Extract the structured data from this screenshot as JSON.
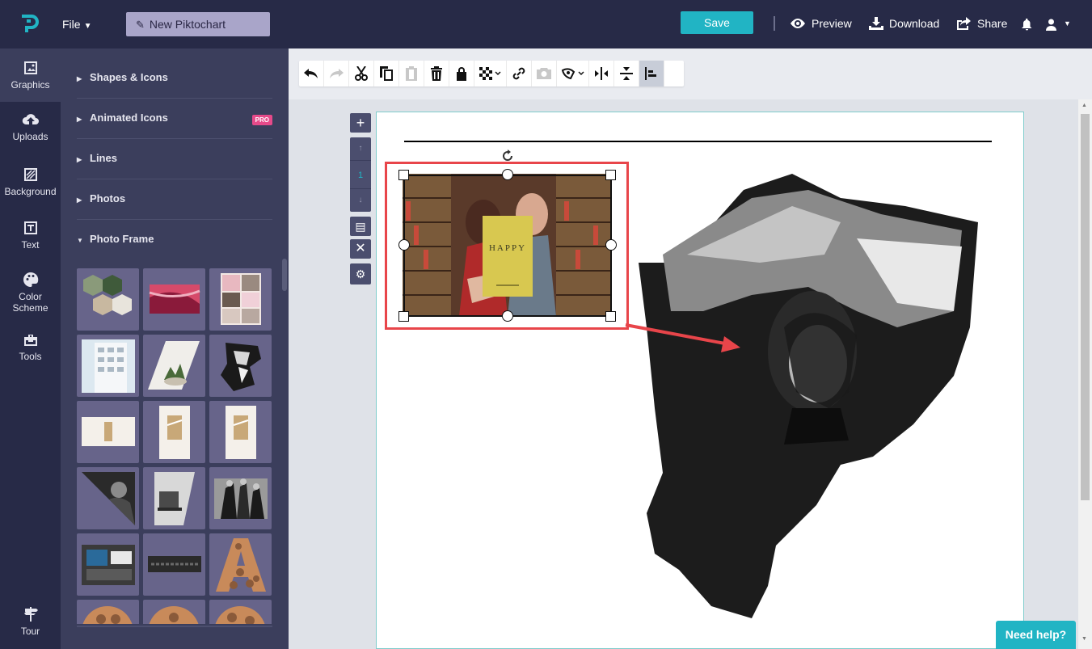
{
  "app": {
    "name": "Piktochart"
  },
  "header": {
    "file_label": "File",
    "doc_title": "New Piktochart",
    "save_label": "Save",
    "preview_label": "Preview",
    "download_label": "Download",
    "share_label": "Share"
  },
  "rail": {
    "items": [
      {
        "label": "Graphics",
        "icon": "image-icon"
      },
      {
        "label": "Uploads",
        "icon": "cloud-upload-icon"
      },
      {
        "label": "Background",
        "icon": "hatch-icon"
      },
      {
        "label": "Text",
        "icon": "text-icon"
      },
      {
        "label": "Color Scheme",
        "icon": "palette-icon"
      },
      {
        "label": "Tools",
        "icon": "toolbox-icon"
      },
      {
        "label": "Tour",
        "icon": "signpost-icon"
      }
    ]
  },
  "panel": {
    "categories": [
      {
        "label": "Shapes & Icons"
      },
      {
        "label": "Animated Icons",
        "badge": "PRO"
      },
      {
        "label": "Lines"
      },
      {
        "label": "Photos"
      },
      {
        "label": "Photo Frame"
      }
    ]
  },
  "canvas": {
    "page_number": "1",
    "selected_image_text": "HAPPY"
  },
  "help": {
    "label": "Need help?"
  },
  "colors": {
    "brand": "#21b4c4",
    "dark": "#272a47",
    "panel": "#3b3e5c",
    "selection": "#e8454a"
  }
}
